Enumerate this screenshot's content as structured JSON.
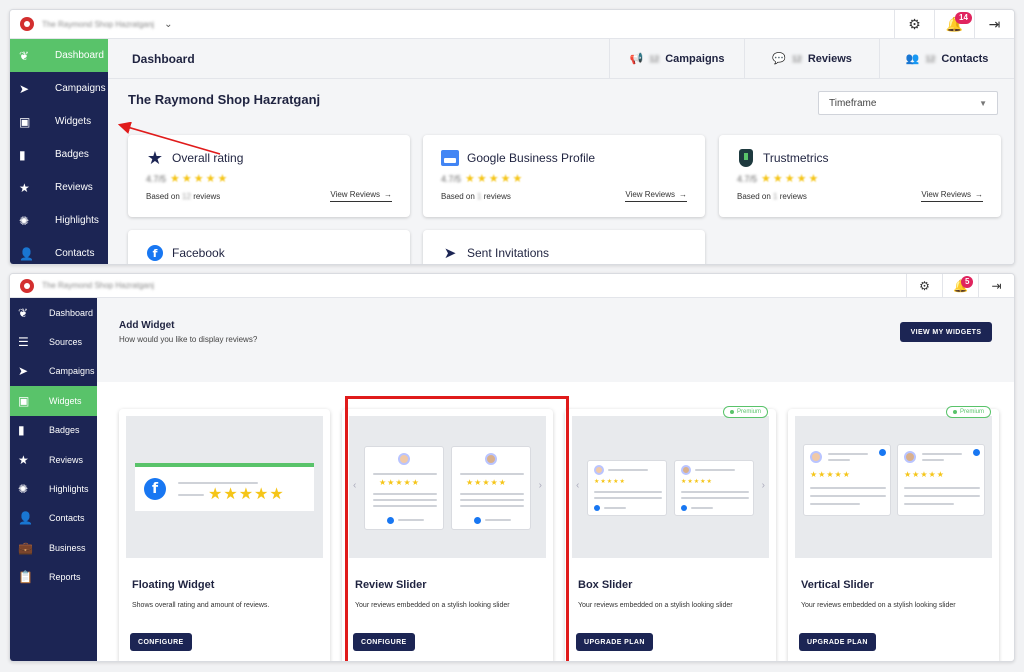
{
  "shot1": {
    "topbar": {
      "shop_name": "The Raymond Shop Hazratganj",
      "notification_count": "14"
    },
    "sidebar": {
      "items": [
        {
          "label": "Dashboard",
          "icon": "logo-icon",
          "active": true
        },
        {
          "label": "Campaigns",
          "icon": "send-icon"
        },
        {
          "label": "Widgets",
          "icon": "widget-icon"
        },
        {
          "label": "Badges",
          "icon": "bookmark-icon"
        },
        {
          "label": "Reviews",
          "icon": "star-icon"
        },
        {
          "label": "Highlights",
          "icon": "lightbulb-icon"
        },
        {
          "label": "Contacts",
          "icon": "contacts-icon"
        }
      ]
    },
    "header": {
      "title": "Dashboard",
      "stats": [
        {
          "label": "Campaigns",
          "count": "12",
          "icon": "megaphone-icon"
        },
        {
          "label": "Reviews",
          "count": "12",
          "icon": "review-bubble-icon"
        },
        {
          "label": "Contacts",
          "count": "12",
          "icon": "people-icon"
        }
      ]
    },
    "shop_heading": "The Raymond Shop Hazratganj",
    "timeframe": {
      "placeholder": "Timeframe"
    },
    "rating_cards": [
      {
        "title": "Overall rating",
        "score": "4.7/5",
        "based_prefix": "Based on",
        "count": "12",
        "based_suffix": "reviews",
        "link": "View Reviews"
      },
      {
        "title": "Google Business Profile",
        "score": "4.7/5",
        "based_prefix": "Based on",
        "count": "1",
        "based_suffix": "reviews",
        "link": "View Reviews"
      },
      {
        "title": "Trustmetrics",
        "score": "4.7/5",
        "based_prefix": "Based on",
        "count": "1",
        "based_suffix": "reviews",
        "link": "View Reviews"
      },
      {
        "title": "Facebook"
      },
      {
        "title": "Sent Invitations"
      }
    ]
  },
  "shot2": {
    "topbar": {
      "shop_name": "The Raymond Shop Hazratganj",
      "notification_count": "5"
    },
    "sidebar": {
      "items": [
        {
          "label": "Dashboard",
          "icon": "logo-icon"
        },
        {
          "label": "Sources",
          "icon": "database-icon"
        },
        {
          "label": "Campaigns",
          "icon": "send-icon"
        },
        {
          "label": "Widgets",
          "icon": "widget-icon",
          "active": true
        },
        {
          "label": "Badges",
          "icon": "bookmark-icon"
        },
        {
          "label": "Reviews",
          "icon": "star-icon"
        },
        {
          "label": "Highlights",
          "icon": "lightbulb-icon"
        },
        {
          "label": "Contacts",
          "icon": "contacts-icon"
        },
        {
          "label": "Business",
          "icon": "briefcase-icon"
        },
        {
          "label": "Reports",
          "icon": "report-icon"
        }
      ]
    },
    "add_widget": {
      "title": "Add Widget",
      "subtitle": "How would you like to display reviews?",
      "view_button": "VIEW MY WIDGETS"
    },
    "widgets": [
      {
        "title": "Floating Widget",
        "desc": "Shows overall rating and amount of reviews.",
        "button": "CONFIGURE",
        "premium": false
      },
      {
        "title": "Review Slider",
        "desc": "Your reviews embedded on a stylish looking slider",
        "button": "CONFIGURE",
        "premium": false
      },
      {
        "title": "Box Slider",
        "desc": "Your reviews embedded on a stylish looking slider",
        "button": "UPGRADE PLAN",
        "premium": true
      },
      {
        "title": "Vertical Slider",
        "desc": "Your reviews embedded on a stylish looking slider",
        "button": "UPGRADE PLAN",
        "premium": true
      }
    ],
    "premium_label": "Premium"
  },
  "colors": {
    "sidebar": "#1c2554",
    "active": "#59c36a",
    "highlight": "#e01b1b",
    "star": "#f5c518",
    "facebook": "#1877f2"
  }
}
